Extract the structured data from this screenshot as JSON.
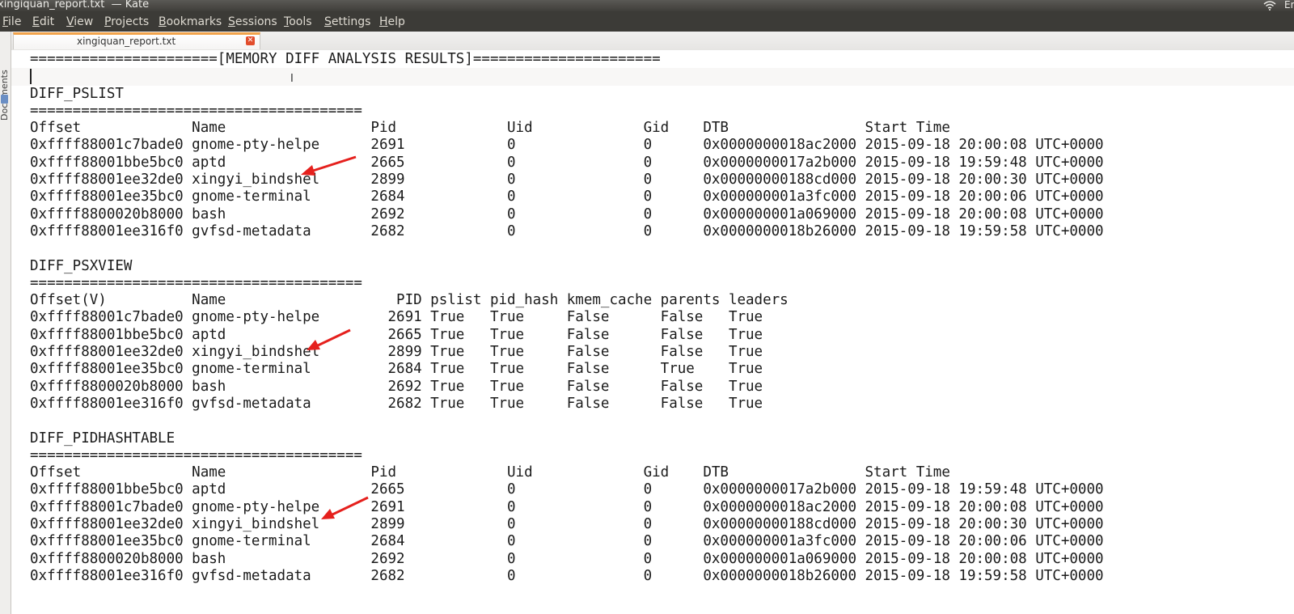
{
  "window": {
    "title": "xingiquan_report.txt  — Kate",
    "tray_wifi_icon": "wifi-icon",
    "tray_lang": "En"
  },
  "menu": [
    {
      "label": "File",
      "mnemonic": "F"
    },
    {
      "label": "Edit",
      "mnemonic": "E"
    },
    {
      "label": "View",
      "mnemonic": "V"
    },
    {
      "label": "Projects",
      "mnemonic": "P"
    },
    {
      "label": "Bookmarks",
      "mnemonic": "B"
    },
    {
      "label": "Sessions",
      "mnemonic": "S"
    },
    {
      "label": "Tools",
      "mnemonic": "T"
    },
    {
      "label": "Settings",
      "mnemonic": "S"
    },
    {
      "label": "Help",
      "mnemonic": "H"
    }
  ],
  "sidebar": {
    "label": "Documents"
  },
  "tab": {
    "label": "xingiquan_report.txt",
    "close_icon": "close-icon"
  },
  "document": {
    "lines": [
      "======================[MEMORY DIFF ANALYSIS RESULTS]======================",
      "",
      "DIFF_PSLIST",
      "=======================================",
      "Offset             Name                 Pid             Uid             Gid    DTB                Start Time",
      "0xffff88001c7bade0 gnome-pty-helpe      2691            0               0      0x0000000018ac2000 2015-09-18 20:00:08 UTC+0000",
      "0xffff88001bbe5bc0 aptd                 2665            0               0      0x0000000017a2b000 2015-09-18 19:59:48 UTC+0000",
      "0xffff88001ee32de0 xingyi_bindshel      2899            0               0      0x00000000188cd000 2015-09-18 20:00:30 UTC+0000",
      "0xffff88001ee35bc0 gnome-terminal       2684            0               0      0x000000001a3fc000 2015-09-18 20:00:06 UTC+0000",
      "0xffff8800020b8000 bash                 2692            0               0      0x000000001a069000 2015-09-18 20:00:08 UTC+0000",
      "0xffff88001ee316f0 gvfsd-metadata       2682            0               0      0x0000000018b26000 2015-09-18 19:59:58 UTC+0000",
      "",
      "DIFF_PSXVIEW",
      "=======================================",
      "Offset(V)          Name                    PID pslist pid_hash kmem_cache parents leaders",
      "0xffff88001c7bade0 gnome-pty-helpe        2691 True   True     False      False   True",
      "0xffff88001bbe5bc0 aptd                   2665 True   True     False      False   True",
      "0xffff88001ee32de0 xingyi_bindshel        2899 True   True     False      False   True",
      "0xffff88001ee35bc0 gnome-terminal         2684 True   True     False      True    True",
      "0xffff8800020b8000 bash                   2692 True   True     False      False   True",
      "0xffff88001ee316f0 gvfsd-metadata         2682 True   True     False      False   True",
      "",
      "DIFF_PIDHASHTABLE",
      "=======================================",
      "Offset             Name                 Pid             Uid             Gid    DTB                Start Time",
      "0xffff88001bbe5bc0 aptd                 2665            0               0      0x0000000017a2b000 2015-09-18 19:59:48 UTC+0000",
      "0xffff88001c7bade0 gnome-pty-helpe      2691            0               0      0x0000000018ac2000 2015-09-18 20:00:08 UTC+0000",
      "0xffff88001ee32de0 xingyi_bindshel      2899            0               0      0x00000000188cd000 2015-09-18 20:00:30 UTC+0000",
      "0xffff88001ee35bc0 gnome-terminal       2684            0               0      0x000000001a3fc000 2015-09-18 20:00:06 UTC+0000",
      "0xffff8800020b8000 bash                 2692            0               0      0x000000001a069000 2015-09-18 20:00:08 UTC+0000",
      "0xffff88001ee316f0 gvfsd-metadata       2682            0               0      0x0000000018b26000 2015-09-18 19:59:58 UTC+0000"
    ]
  },
  "annotations": {
    "color": "#e5201d",
    "kind": "arrow-icon"
  }
}
